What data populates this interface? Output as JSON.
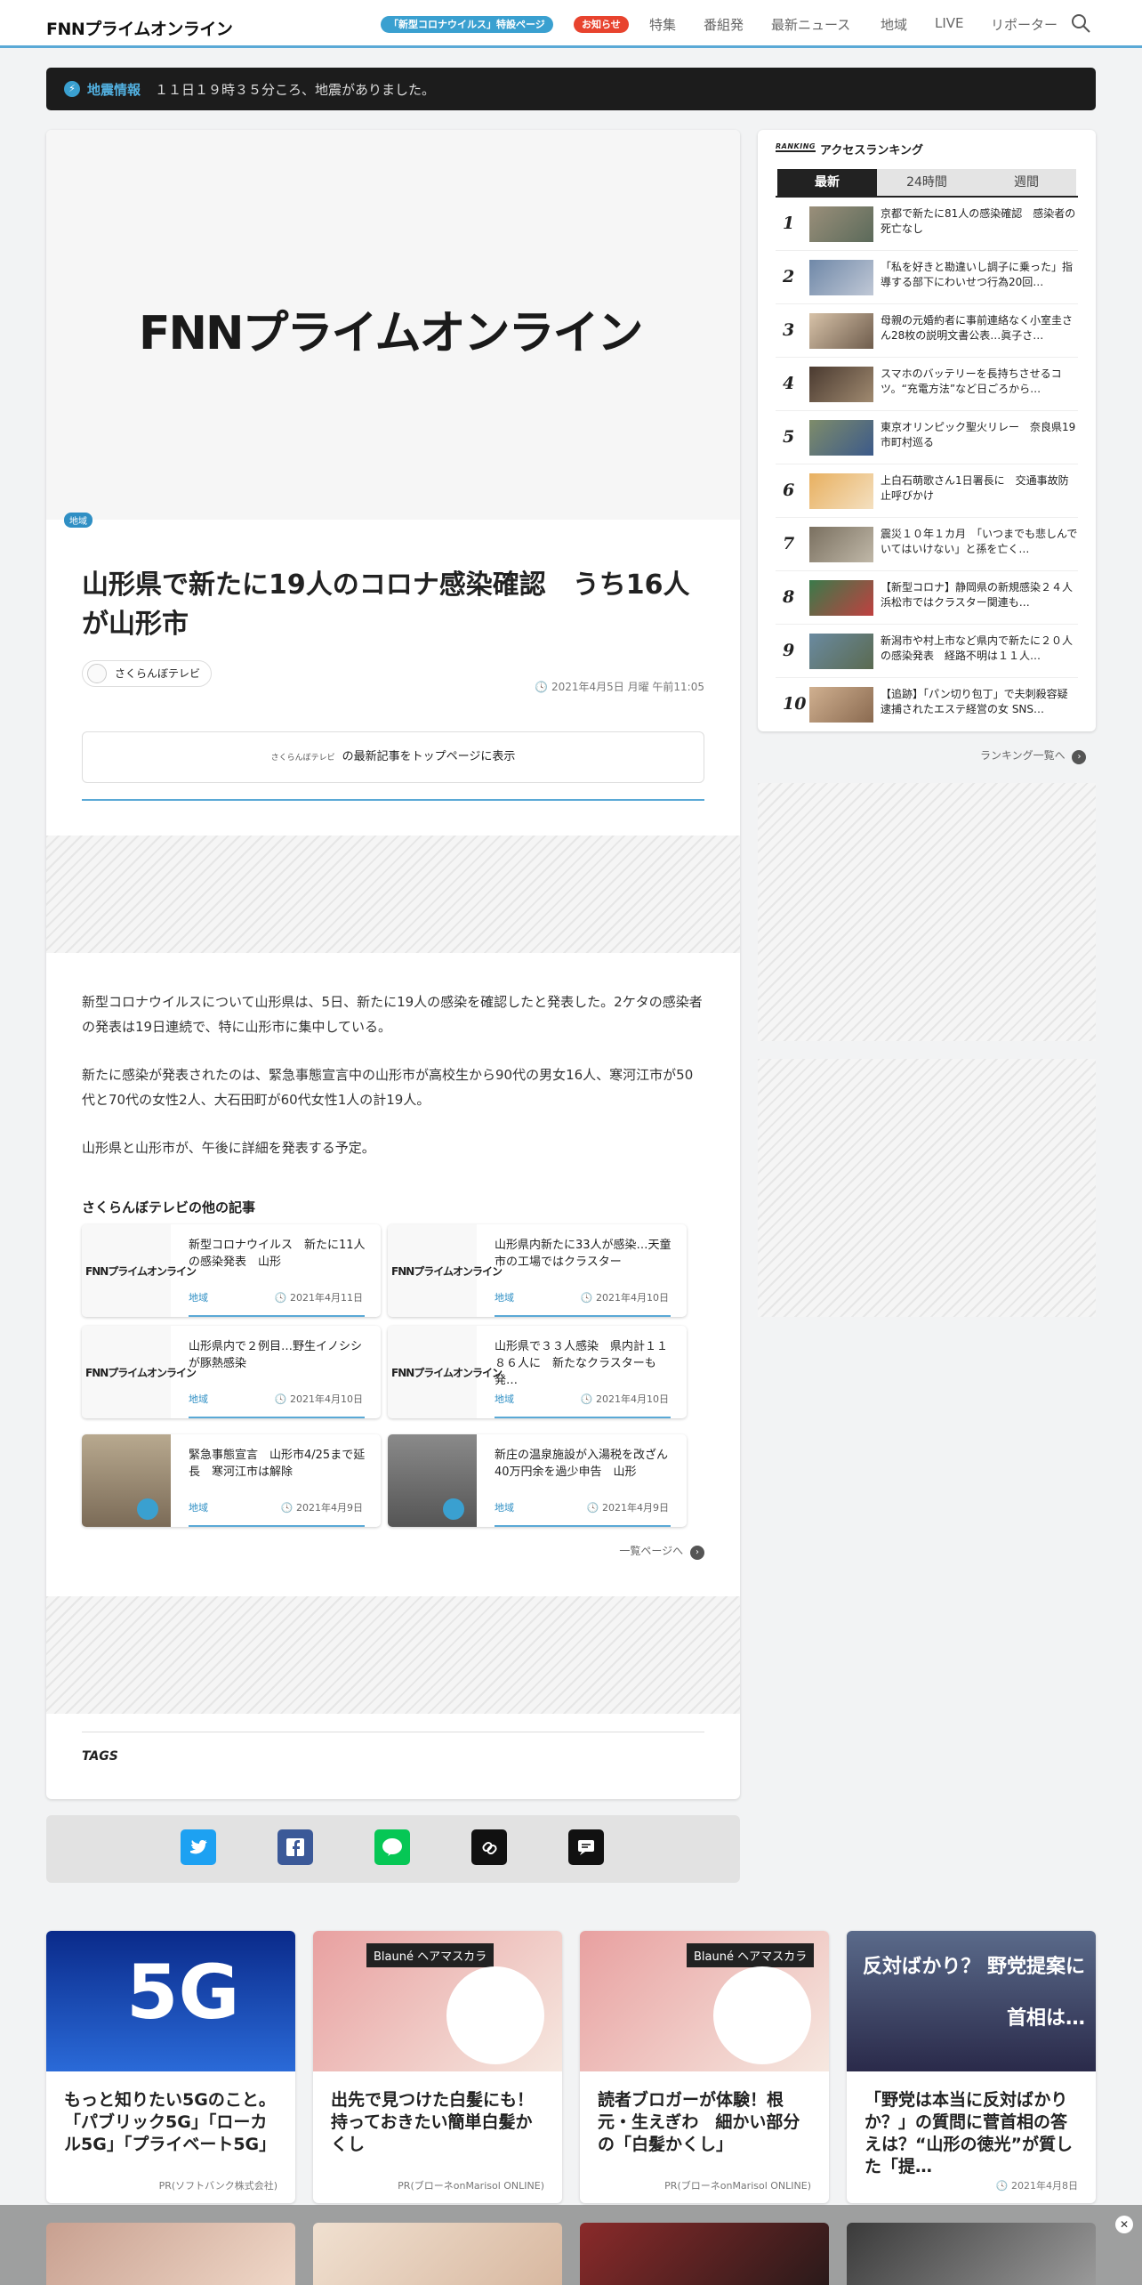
{
  "header": {
    "logo": "FNNプライムオンライン",
    "special_pill": "「新型コロナウイルス」特設ページ",
    "notice_pill": "お知らせ",
    "nav": [
      "特集",
      "番組発",
      "最新ニュース",
      "地域",
      "LIVE",
      "リポーター"
    ]
  },
  "alert": {
    "label": "地震情報",
    "text": "１１日１９時３５分ころ、地震がありました。"
  },
  "article": {
    "hero_logo": "FNNプライムオンライン",
    "category": "地域",
    "title": "山形県で新たに19人のコロナ感染確認　うち16人が山形市",
    "source": "さくらんぼテレビ",
    "date": "2021年4月5日 月曜 午前11:05",
    "top_link": "の最新記事をトップページに表示",
    "top_link_logo": "さくらんぼテレビ",
    "paragraphs": [
      "新型コロナウイルスについて山形県は、5日、新たに19人の感染を確認したと発表した。2ケタの感染者の発表は19日連続で、特に山形市に集中している。",
      "新たに感染が発表されたのは、緊急事態宣言中の山形市が高校生から90代の男女16人、寒河江市が50代と70代の女性2人、大石田町が60代女性1人の計19人。",
      "山形県と山形市が、午後に詳細を発表する予定。"
    ],
    "other_heading": "さくらんぼテレビの他の記事",
    "other_articles": [
      {
        "title": "新型コロナウイルス　新たに11人の感染発表　山形",
        "tag": "地域",
        "date": "2021年4月11日",
        "thumb": "FNNプライムオンライン"
      },
      {
        "title": "山形県内新たに33人が感染…天童市の工場ではクラスター",
        "tag": "地域",
        "date": "2021年4月10日",
        "thumb": "FNNプライムオンライン"
      },
      {
        "title": "山形県内で２例目…野生イノシシが豚熱感染",
        "tag": "地域",
        "date": "2021年4月10日",
        "thumb": "FNNプライムオンライン"
      },
      {
        "title": "山形県で３３人感染　県内計１１８６人に　新たなクラスターも発…",
        "tag": "地域",
        "date": "2021年4月10日",
        "thumb": "FNNプライムオンライン"
      },
      {
        "title": "緊急事態宣言　山形市4/25まで延長　寒河江市は解除",
        "tag": "地域",
        "date": "2021年4月9日",
        "thumb": ""
      },
      {
        "title": "新庄の温泉施設が入湯税を改ざん　40万円余を過少申告　山形",
        "tag": "地域",
        "date": "2021年4月9日",
        "thumb": ""
      }
    ],
    "list_link": "一覧ページへ",
    "tags_label": "TAGS"
  },
  "ranking": {
    "badge": "RANKING",
    "heading": "アクセスランキング",
    "tabs": [
      "最新",
      "24時間",
      "週間"
    ],
    "items": [
      {
        "rank": "1",
        "title": "京都で新たに81人の感染確認　感染者の死亡なし"
      },
      {
        "rank": "2",
        "title": "「私を好きと勘違いし調子に乗った」指導する部下にわいせつ行為20回…"
      },
      {
        "rank": "3",
        "title": "母親の元婚約者に事前連絡なく小室圭さん28枚の説明文書公表…眞子さ…"
      },
      {
        "rank": "4",
        "title": "スマホのバッテリーを長持ちさせるコツ。“充電方法”など日ごろから…"
      },
      {
        "rank": "5",
        "title": "東京オリンピック聖火リレー　奈良県19市町村巡る"
      },
      {
        "rank": "6",
        "title": "上白石萌歌さん1日署長に　交通事故防止呼びかけ"
      },
      {
        "rank": "7",
        "title": "震災１０年１カ月　「いつまでも悲しんでいてはいけない」と孫を亡く…"
      },
      {
        "rank": "8",
        "title": "【新型コロナ】静岡県の新規感染２４人　浜松市ではクラスター関連も…"
      },
      {
        "rank": "9",
        "title": "新潟市や村上市など県内で新たに２０人の感染発表　経路不明は１１人…"
      },
      {
        "rank": "10",
        "title": "【追跡】「パン切り包丁」で夫刺殺容疑 逮捕されたエステ経営の女 SNS…"
      }
    ],
    "more": "ランキング一覧へ"
  },
  "pr_cards": [
    {
      "title": "もっと知りたい5Gのこと。「パブリック5G」「ローカル5G」「プライベート5G」",
      "source": "PR(ソフトバンク株式会社)",
      "img_text": "5G"
    },
    {
      "title": "出先で見つけた白髪にも！持っておきたい簡単白髪かくし",
      "source": "PR(ブローネonMarisol ONLINE)",
      "img_text": "Blauné ヘアマスカラ"
    },
    {
      "title": "読者ブロガーが体験！根元・生えぎわ　細かい部分の「白髪かくし」",
      "source": "PR(ブローネonMarisol ONLINE)",
      "img_text": "Blauné ヘアマスカラ"
    },
    {
      "title": "「野党は本当に反対ばかりか？」の質問に菅首相の答えは？“山形の徳光”が質した「提…",
      "source": "2021年4月8日",
      "img_text": "反対ばかり？ 野党提案に首相は…"
    }
  ],
  "colors": {
    "accent": "#5aa9d6",
    "notice": "#e8432e",
    "alert_bg": "#1c1c1c"
  }
}
